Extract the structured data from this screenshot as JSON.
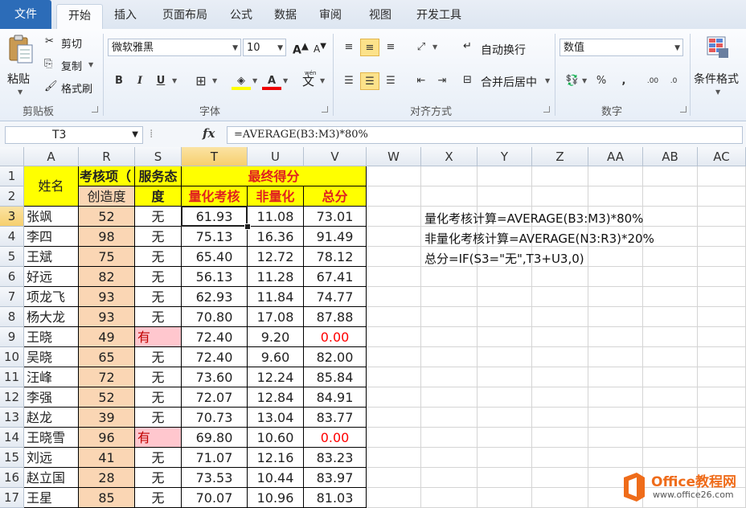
{
  "tabs": {
    "file": "文件",
    "items": [
      "开始",
      "插入",
      "页面布局",
      "公式",
      "数据",
      "审阅",
      "视图",
      "开发工具"
    ],
    "active_index": 0
  },
  "ribbon": {
    "clipboard": {
      "paste": "粘贴",
      "cut": "剪切",
      "copy": "复制",
      "format_painter": "格式刷",
      "group": "剪贴板"
    },
    "font": {
      "name": "微软雅黑",
      "size": "10",
      "bold": "B",
      "italic": "I",
      "underline": "U",
      "group": "字体",
      "grow": "A",
      "shrink": "A",
      "wen": "wén",
      "wen_char": "文"
    },
    "alignment": {
      "wrap": "自动换行",
      "merge": "合并后居中",
      "group": "对齐方式"
    },
    "number": {
      "format": "数值",
      "percent": "%",
      "comma": ",",
      "inc": ".00",
      "dec": ".0",
      "group": "数字"
    },
    "styles": {
      "conditional": "条件格式"
    }
  },
  "formula_bar": {
    "name_box": "T3",
    "fx": "fx",
    "formula": "=AVERAGE(B3:M3)*80%"
  },
  "colors": {
    "yellow": "#ffff00",
    "peach": "#fad6b4",
    "pink": "#ffc7ce",
    "red": "#ff0000",
    "header_red": "#e02020",
    "accent": "#2c6cb8"
  },
  "columns": [
    "A",
    "R",
    "S",
    "T",
    "U",
    "V",
    "W",
    "X",
    "Y",
    "Z",
    "AA",
    "AB",
    "AC"
  ],
  "header": {
    "name": "姓名",
    "r1": "考核项（",
    "r2": "创造度",
    "s1": "服务态",
    "s2": "度",
    "final": "最终得分",
    "t2": "量化考核",
    "u2": "非量化",
    "v2": "总分"
  },
  "rows": [
    {
      "n": "3",
      "name": "张飒",
      "r": "52",
      "s": "无",
      "t": "61.93",
      "u": "11.08",
      "v": "73.01"
    },
    {
      "n": "4",
      "name": "李四",
      "r": "98",
      "s": "无",
      "t": "75.13",
      "u": "16.36",
      "v": "91.49"
    },
    {
      "n": "5",
      "name": "王斌",
      "r": "75",
      "s": "无",
      "t": "65.40",
      "u": "12.72",
      "v": "78.12"
    },
    {
      "n": "6",
      "name": "好远",
      "r": "82",
      "s": "无",
      "t": "56.13",
      "u": "11.28",
      "v": "67.41"
    },
    {
      "n": "7",
      "name": "项龙飞",
      "r": "93",
      "s": "无",
      "t": "62.93",
      "u": "11.84",
      "v": "74.77"
    },
    {
      "n": "8",
      "name": "杨大龙",
      "r": "93",
      "s": "无",
      "t": "70.80",
      "u": "17.08",
      "v": "87.88"
    },
    {
      "n": "9",
      "name": "王晓",
      "r": "49",
      "s": "有",
      "t": "72.40",
      "u": "9.20",
      "v": "0.00"
    },
    {
      "n": "10",
      "name": "吴晓",
      "r": "65",
      "s": "无",
      "t": "72.40",
      "u": "9.60",
      "v": "82.00"
    },
    {
      "n": "11",
      "name": "汪峰",
      "r": "72",
      "s": "无",
      "t": "73.60",
      "u": "12.24",
      "v": "85.84"
    },
    {
      "n": "12",
      "name": "李强",
      "r": "52",
      "s": "无",
      "t": "72.07",
      "u": "12.84",
      "v": "84.91"
    },
    {
      "n": "13",
      "name": "赵龙",
      "r": "39",
      "s": "无",
      "t": "70.73",
      "u": "13.04",
      "v": "83.77"
    },
    {
      "n": "14",
      "name": "王晓雪",
      "r": "96",
      "s": "有",
      "t": "69.80",
      "u": "10.60",
      "v": "0.00"
    },
    {
      "n": "15",
      "name": "刘远",
      "r": "41",
      "s": "无",
      "t": "71.07",
      "u": "12.16",
      "v": "83.23"
    },
    {
      "n": "16",
      "name": "赵立国",
      "r": "28",
      "s": "无",
      "t": "73.53",
      "u": "10.44",
      "v": "83.97"
    },
    {
      "n": "17",
      "name": "王星",
      "r": "85",
      "s": "无",
      "t": "70.07",
      "u": "10.96",
      "v": "81.03"
    }
  ],
  "notes": [
    "量化考核计算=AVERAGE(B3:M3)*80%",
    "非量化考核计算=AVERAGE(N3:R3)*20%",
    "总分=IF(S3=\"无\",T3+U3,0)"
  ],
  "watermark": {
    "brand": "Office教程网",
    "url": "www.office26.com"
  }
}
